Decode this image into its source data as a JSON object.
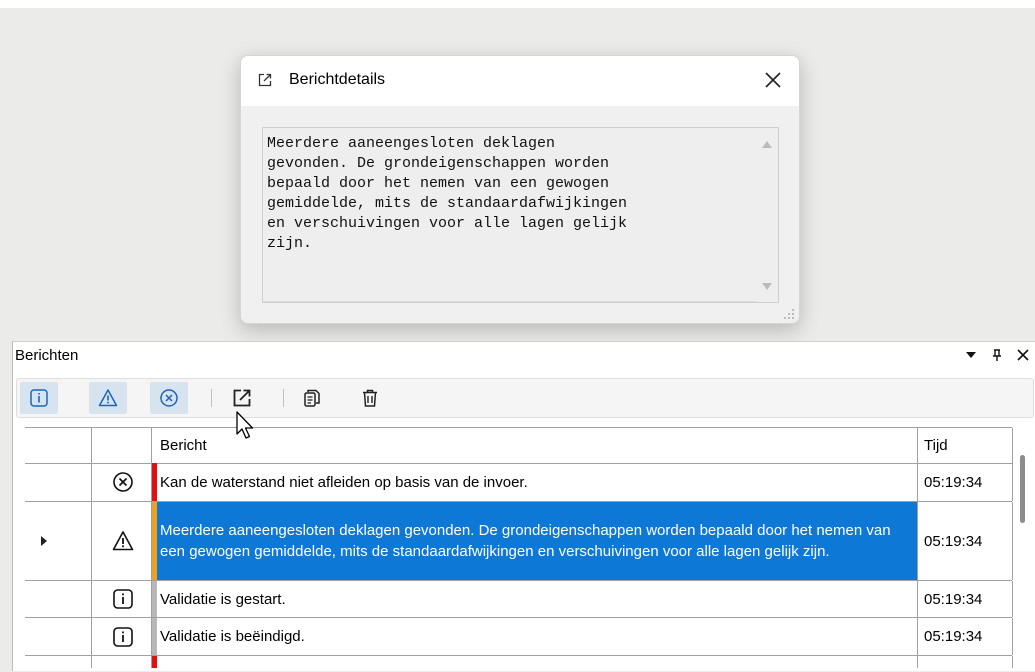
{
  "dialog": {
    "title": "Berichtdetails",
    "title_icon": "edit-icon",
    "close_icon": "close-icon",
    "message": "Meerdere aaneengesloten deklagen\ngevonden. De grondeigenschappen worden\nbepaald door het nemen van een gewogen\ngemiddelde, mits de standaardafwijkingen\nen verschuivingen voor alle lagen gelijk\nzijn."
  },
  "panel": {
    "title": "Berichten",
    "controls": [
      "dropdown-icon",
      "pin-icon",
      "close-icon"
    ]
  },
  "toolbar": {
    "buttons": [
      {
        "name": "info-filter-button",
        "icon": "info-icon",
        "active": true
      },
      {
        "name": "warning-filter-button",
        "icon": "warning-icon",
        "active": true
      },
      {
        "name": "error-filter-button",
        "icon": "error-icon",
        "active": true
      },
      {
        "name": "open-details-button",
        "icon": "open-dialog-icon",
        "active": false
      },
      {
        "name": "copy-button",
        "icon": "copy-icon",
        "active": false
      },
      {
        "name": "delete-button",
        "icon": "trash-icon",
        "active": false
      }
    ]
  },
  "table": {
    "headers": {
      "message": "Bericht",
      "time": "Tijd"
    },
    "rows": [
      {
        "type": "error",
        "message": "Kan de waterstand niet afleiden op basis van de invoer.",
        "time": "05:19:34",
        "selected": false
      },
      {
        "type": "warning",
        "message": "Meerdere aaneengesloten deklagen gevonden. De grondeigenschappen worden bepaald door het nemen van een gewogen gemiddelde, mits de standaardafwijkingen en verschuivingen voor alle lagen gelijk zijn.",
        "time": "05:19:34",
        "selected": true
      },
      {
        "type": "info",
        "message": "Validatie is gestart.",
        "time": "05:19:34",
        "selected": false
      },
      {
        "type": "info",
        "message": "Validatie is beëindigd.",
        "time": "05:19:34",
        "selected": false
      }
    ]
  },
  "colors": {
    "error": "#e01010",
    "warning": "#f0a020",
    "info": "#b8b8b8",
    "selection": "#0e78d6",
    "toolbar_icon": "#1a66b8"
  }
}
